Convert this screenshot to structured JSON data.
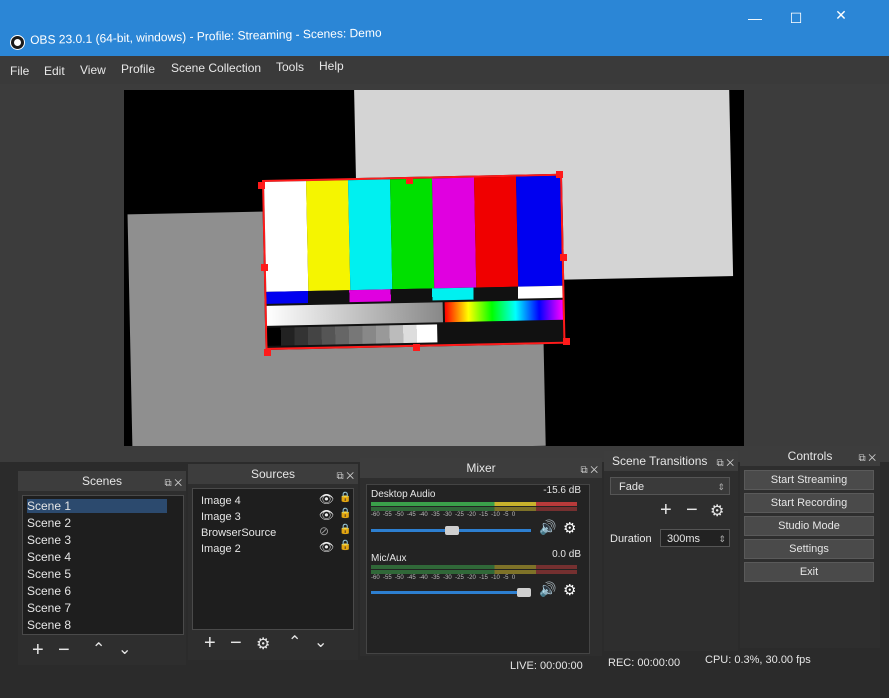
{
  "window": {
    "title": "OBS 23.0.1 (64-bit, windows) - Profile: Streaming - Scenes: Demo",
    "minimize": "—",
    "maximize": "☐",
    "close": "✕"
  },
  "menu": [
    "File",
    "Edit",
    "View",
    "Profile",
    "Scene Collection",
    "Tools",
    "Help"
  ],
  "docks": {
    "scenes": {
      "title": "Scenes",
      "items": [
        "Scene 1",
        "Scene 2",
        "Scene 3",
        "Scene 4",
        "Scene 5",
        "Scene 6",
        "Scene 7",
        "Scene 8"
      ],
      "selected": 0
    },
    "sources": {
      "title": "Sources",
      "items": [
        "Image 4",
        "Image 3",
        "BrowserSource",
        "Image 2"
      ]
    },
    "mixer": {
      "title": "Mixer",
      "channels": [
        {
          "name": "Desktop Audio",
          "level": "-15.6 dB",
          "volume": 0.45
        },
        {
          "name": "Mic/Aux",
          "level": "0.0 dB",
          "volume": 1.0
        }
      ],
      "scale": [
        "-60",
        "-55",
        "-50",
        "-45",
        "-40",
        "-35",
        "-30",
        "-25",
        "-20",
        "-15",
        "-10",
        "-5",
        "0"
      ]
    },
    "transitions": {
      "title": "Scene Transitions",
      "selected": "Fade",
      "duration_label": "Duration",
      "duration_value": "300ms"
    },
    "controls": {
      "title": "Controls",
      "buttons": [
        "Start Streaming",
        "Start Recording",
        "Studio Mode",
        "Settings",
        "Exit"
      ]
    }
  },
  "status": {
    "live": "LIVE: 00:00:00",
    "rec": "REC: 00:00:00",
    "cpu": "CPU: 0.3%, 30.00 fps"
  },
  "colors": {
    "accent": "#2b86d6",
    "selection": "#ff1a1a"
  }
}
